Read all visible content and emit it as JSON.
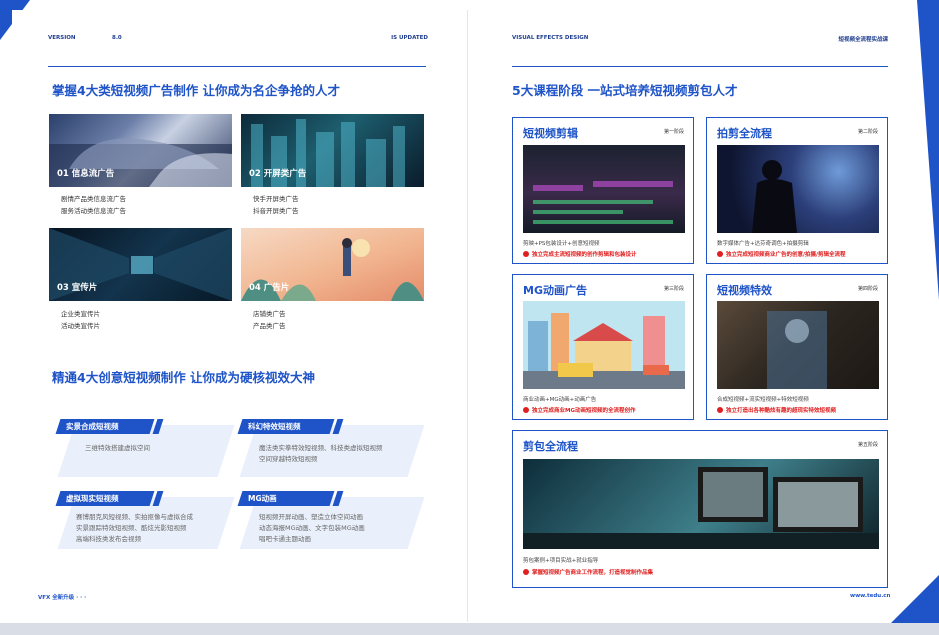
{
  "left": {
    "header": {
      "version_label": "VERSION",
      "version_num": "8.0",
      "updated": "IS UPDATED"
    },
    "section1_title": "掌握4大类短视频广告制作  让你成为名企争抢的人才",
    "ads": [
      {
        "caption": "01 信息流广告",
        "lines": [
          "剧情产品类信息流广告",
          "服务活动类信息流广告"
        ]
      },
      {
        "caption": "02 开屏类广告",
        "lines": [
          "快手开屏类广告",
          "抖音开屏类广告"
        ]
      },
      {
        "caption": "03 宣传片",
        "lines": [
          "企业类宣传片",
          "活动类宣传片"
        ]
      },
      {
        "caption": "04 广告片",
        "lines": [
          "店铺类广告",
          "产品类广告"
        ]
      }
    ],
    "section2_title": "精通4大创意短视频制作  让你成为硬核视效大神",
    "creative": [
      {
        "tag": "实景合成短视频",
        "lines": [
          "三维特效搭建虚拟空间"
        ]
      },
      {
        "tag": "科幻特效短视频",
        "lines": [
          "魔法类实拳特效短视频、科技类虚拟短视频",
          "空间穿越特效短视频"
        ]
      },
      {
        "tag": "虚拟现实短视频",
        "lines": [
          "赛博朋克风短视频、实拍抠像与虚拟合成",
          "实景跟踪特效短视频、酷炫光影短视频",
          "高端科技类发布会视频"
        ]
      },
      {
        "tag": "MG动画",
        "lines": [
          "短视频开屏动画、塑造立体空间动画",
          "动态海报MG动画、文字包装MG动画",
          "唱吧卡通主题动画"
        ]
      }
    ],
    "footer": "VFX 全新升级  · · ·"
  },
  "right": {
    "header": {
      "left": "VISUAL EFFECTS DESIGN",
      "right": "短视频全流程实战课"
    },
    "title": "5大课程阶段  一站式培养短视频剪包人才",
    "cards": [
      {
        "title": "短视频剪辑",
        "stage": "第一阶段",
        "desc": "剪映+PS包装设计+创意短视频",
        "highlight": "独立完成主流短视频的创作剪辑和包装设计"
      },
      {
        "title": "拍剪全流程",
        "stage": "第二阶段",
        "desc": "数字媒体广告+达芬奇调色+拍摄剪辑",
        "highlight": "独立完成短视频商业广告的创意/拍摄/剪辑全流程"
      },
      {
        "title": "MG动画广告",
        "stage": "第三阶段",
        "desc": "商业动画+MG动画+动画广告",
        "highlight": "独立完成商业MG动画短视频的全流程创作"
      },
      {
        "title": "短视频特效",
        "stage": "第四阶段",
        "desc": "合成短视频+流实短视频+特效短视频",
        "highlight": "独立打造出各种酷炫有趣的超现实特效短视频"
      },
      {
        "title": "剪包全流程",
        "stage": "第五阶段",
        "desc": "剪包案例+项目实战+就业指导",
        "highlight": "掌握短视频广告商业工作流程，打造视觉制作品集"
      }
    ],
    "footer": "www.tedu.cn"
  }
}
